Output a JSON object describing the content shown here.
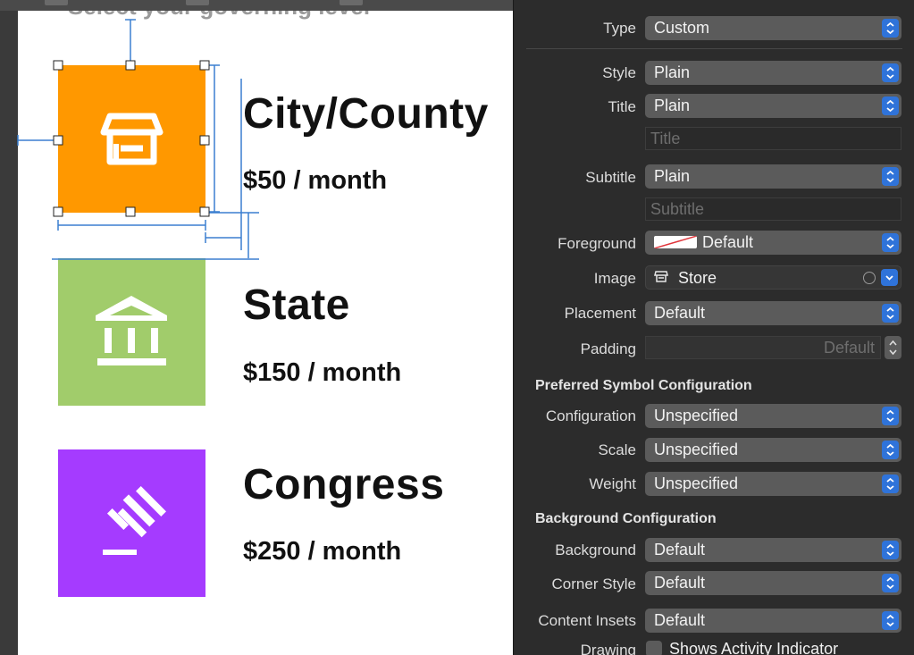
{
  "canvas": {
    "header_cut": "Select your governing level",
    "rows": [
      {
        "title": "City/County",
        "price": "$50 / month",
        "color": "#ff9800",
        "icon": "store-icon"
      },
      {
        "title": "State",
        "price": "$150 / month",
        "color": "#a1cc6b",
        "icon": "building-columns-icon"
      },
      {
        "title": "Congress",
        "price": "$250 / month",
        "color": "#a53bff",
        "icon": "gavel-icon"
      }
    ]
  },
  "inspector": {
    "type": {
      "label": "Type",
      "value": "Custom"
    },
    "style": {
      "label": "Style",
      "value": "Plain"
    },
    "title": {
      "label": "Title",
      "value": "Plain",
      "placeholder": "Title"
    },
    "subtitle": {
      "label": "Subtitle",
      "value": "Plain",
      "placeholder": "Subtitle"
    },
    "foreground": {
      "label": "Foreground",
      "value": "Default"
    },
    "image": {
      "label": "Image",
      "value": "Store",
      "icon": "store-icon"
    },
    "placement": {
      "label": "Placement",
      "value": "Default"
    },
    "padding": {
      "label": "Padding",
      "placeholder": "Default"
    },
    "symbol_section": "Preferred Symbol Configuration",
    "configuration": {
      "label": "Configuration",
      "value": "Unspecified"
    },
    "scale": {
      "label": "Scale",
      "value": "Unspecified"
    },
    "weight": {
      "label": "Weight",
      "value": "Unspecified"
    },
    "background_section": "Background Configuration",
    "background": {
      "label": "Background",
      "value": "Default"
    },
    "corner_style": {
      "label": "Corner Style",
      "value": "Default"
    },
    "content_insets": {
      "label": "Content Insets",
      "value": "Default"
    },
    "drawing": {
      "label": "Drawing",
      "checkbox_label": "Shows Activity Indicator",
      "checked": false
    }
  },
  "colors": {
    "accent": "#2f73d9",
    "selection": "#3b7fd0"
  }
}
